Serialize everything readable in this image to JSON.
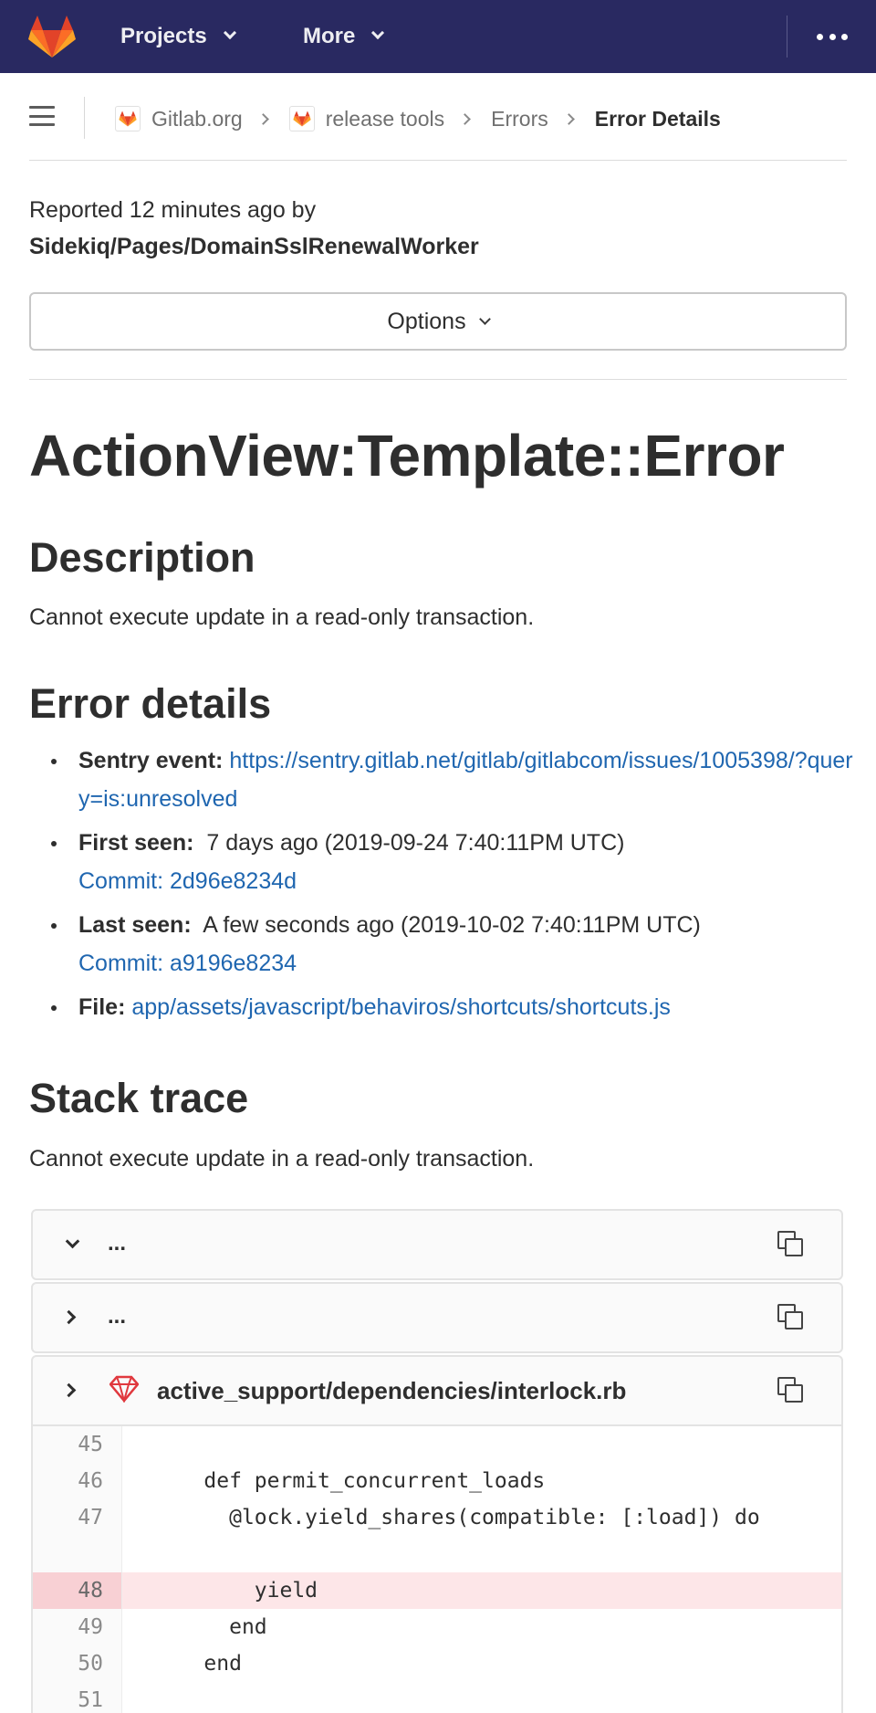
{
  "topbar": {
    "nav": [
      {
        "label": "Projects"
      },
      {
        "label": "More"
      }
    ]
  },
  "breadcrumb": {
    "items": [
      {
        "label": "Gitlab.org"
      },
      {
        "label": "release tools"
      },
      {
        "label": "Errors"
      },
      {
        "label": "Error Details"
      }
    ]
  },
  "report": {
    "reported": "Reported 12 minutes ago by",
    "culprit": "Sidekiq/Pages/DomainSslRenewalWorker"
  },
  "options_label": "Options",
  "error": {
    "title": "ActionView:Template::Error",
    "description_heading": "Description",
    "description": "Cannot execute update in a read-only transaction.",
    "details_heading": "Error details",
    "details": {
      "sentry_label": "Sentry event:",
      "sentry_url": "https://sentry.gitlab.net/gitlab/gitlabcom/issues/1005398/?query=is:unresolved",
      "first_seen_label": "First seen:",
      "first_seen_value": "7 days ago (2019-09-24 7:40:11PM UTC)",
      "first_commit": "Commit: 2d96e8234d",
      "last_seen_label": "Last seen:",
      "last_seen_value": "A few seconds ago (2019-10-02 7:40:11PM UTC)",
      "last_commit": "Commit: a9196e8234",
      "file_label": "File:",
      "file_value": "app/assets/javascript/behaviros/shortcuts/shortcuts.js"
    }
  },
  "stack": {
    "heading": "Stack trace",
    "message": "Cannot execute update in a read-only transaction.",
    "frames": [
      {
        "label": "..."
      },
      {
        "label": "..."
      },
      {
        "label": "active_support/dependencies/interlock.rb"
      }
    ],
    "code_lines": [
      {
        "num": "45",
        "code": ""
      },
      {
        "num": "46",
        "code": "    def permit_concurrent_loads"
      },
      {
        "num": "47",
        "code": "      @lock.yield_shares(compatible: [:load]) do"
      },
      {
        "num": "48",
        "code": "        yield"
      },
      {
        "num": "49",
        "code": "      end"
      },
      {
        "num": "50",
        "code": "    end"
      },
      {
        "num": "51",
        "code": ""
      }
    ]
  },
  "colors": {
    "topbar": "#292961",
    "link": "#1f66b0",
    "highlight_line": "#fde6e8"
  }
}
